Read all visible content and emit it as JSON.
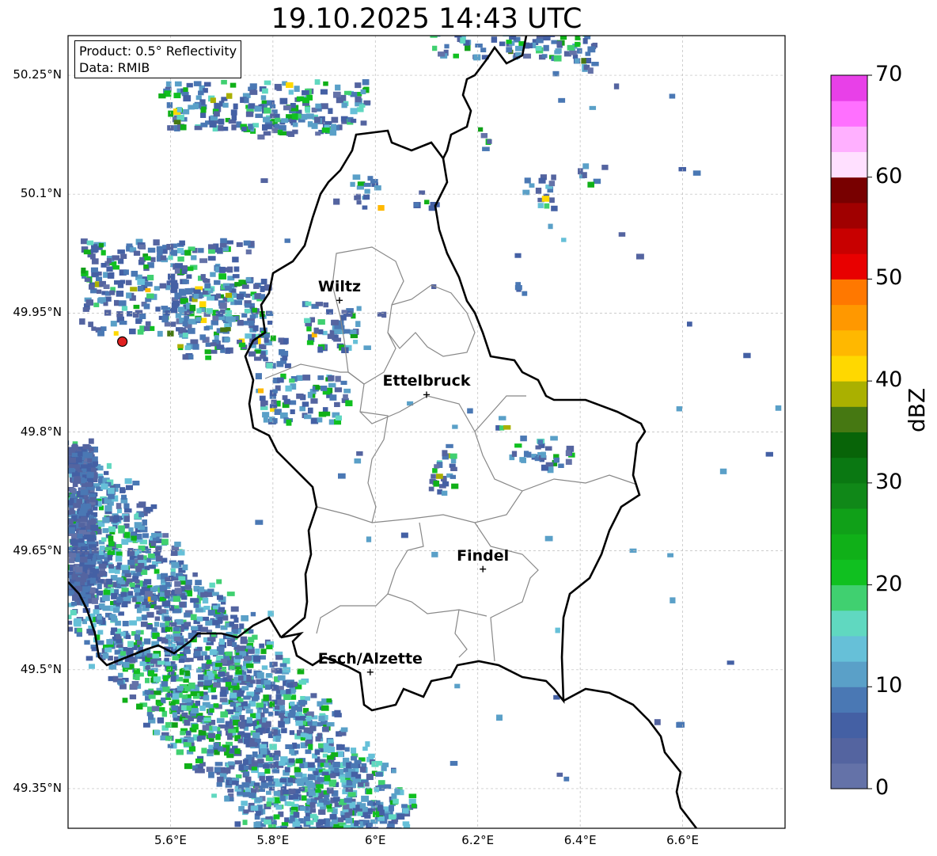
{
  "title": "19.10.2025 14:43 UTC",
  "info": {
    "product": "Product: 0.5° Reflectivity",
    "source": "Data: RMIB"
  },
  "map": {
    "lon_range": [
      5.4,
      6.8
    ],
    "lat_range": [
      49.3,
      50.3
    ],
    "lat_ticks": [
      {
        "value": 50.25,
        "label": "50.25°N"
      },
      {
        "value": 50.1,
        "label": "50.1°N"
      },
      {
        "value": 49.95,
        "label": "49.95°N"
      },
      {
        "value": 49.8,
        "label": "49.8°N"
      },
      {
        "value": 49.65,
        "label": "49.65°N"
      },
      {
        "value": 49.5,
        "label": "49.5°N"
      },
      {
        "value": 49.35,
        "label": "49.35°N"
      }
    ],
    "lon_ticks": [
      {
        "value": 5.6,
        "label": "5.6°E"
      },
      {
        "value": 5.8,
        "label": "5.8°E"
      },
      {
        "value": 6.0,
        "label": "6°E"
      },
      {
        "value": 6.2,
        "label": "6.2°E"
      },
      {
        "value": 6.4,
        "label": "6.4°E"
      },
      {
        "value": 6.6,
        "label": "6.6°E"
      }
    ],
    "cities": [
      {
        "name": "Wiltz",
        "lon": 5.93,
        "lat": 49.966
      },
      {
        "name": "Ettelbruck",
        "lon": 6.1,
        "lat": 49.847
      },
      {
        "name": "Findel",
        "lon": 6.21,
        "lat": 49.627
      },
      {
        "name": "Esch/Alzette",
        "lon": 5.99,
        "lat": 49.497
      }
    ],
    "radar_site": {
      "lon": 5.506,
      "lat": 49.914,
      "color": "#e02020"
    },
    "border_color": "#000000",
    "canton_color": "#888888"
  },
  "colorbar": {
    "label": "dBZ",
    "min": 0,
    "max": 70,
    "ticks": [
      {
        "value": 0,
        "label": "0"
      },
      {
        "value": 10,
        "label": "10"
      },
      {
        "value": 20,
        "label": "20"
      },
      {
        "value": 30,
        "label": "30"
      },
      {
        "value": 40,
        "label": "40"
      },
      {
        "value": 50,
        "label": "50"
      },
      {
        "value": 60,
        "label": "60"
      },
      {
        "value": 70,
        "label": "70"
      }
    ],
    "colors": [
      "#6472a8",
      "#5464a0",
      "#4460a4",
      "#4a78b4",
      "#5aa0c8",
      "#66c0d8",
      "#60d8c0",
      "#40d070",
      "#10c020",
      "#10b018",
      "#10a018",
      "#108818",
      "#0a7812",
      "#086408",
      "#467812",
      "#aab000",
      "#ffd800",
      "#ffb800",
      "#ff9800",
      "#ff7800",
      "#e80000",
      "#c80000",
      "#a00000",
      "#780000",
      "#ffe0ff",
      "#ffb0ff",
      "#ff70ff",
      "#e840e8"
    ]
  }
}
